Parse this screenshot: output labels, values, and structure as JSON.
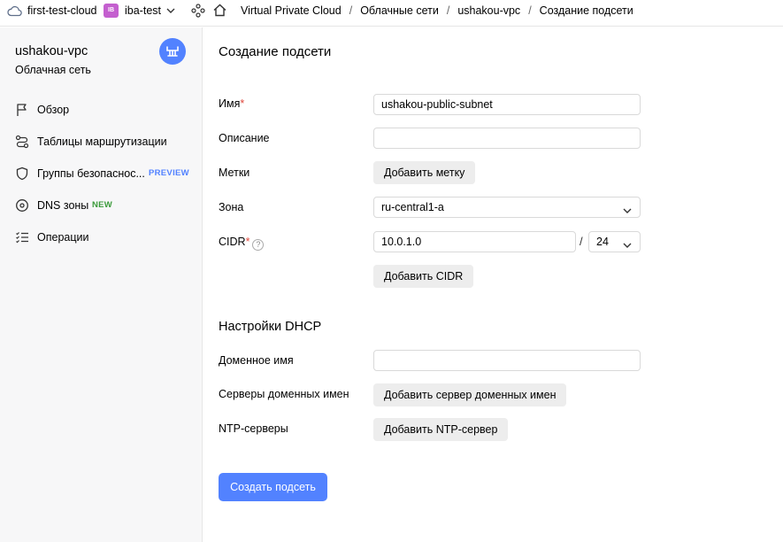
{
  "topbar": {
    "cloud_name": "first-test-cloud",
    "folder_badge": "IB",
    "folder_name": "iba-test",
    "breadcrumbs": [
      "Virtual Private Cloud",
      "Облачные сети",
      "ushakou-vpc",
      "Создание подсети"
    ],
    "icons": [
      "cloud-icon",
      "chevron-down-icon",
      "services-icon",
      "home-icon"
    ]
  },
  "sidebar": {
    "title": "ushakou-vpc",
    "subtitle": "Облачная сеть",
    "items": [
      {
        "label": "Обзор",
        "icon": "flag-icon"
      },
      {
        "label": "Таблицы маршрутизации",
        "icon": "route-icon"
      },
      {
        "label": "Группы безопаснос...",
        "icon": "shield-icon",
        "badge": "PREVIEW"
      },
      {
        "label": "DNS зоны",
        "icon": "compass-icon",
        "badge": "NEW"
      },
      {
        "label": "Операции",
        "icon": "list-icon"
      }
    ]
  },
  "form": {
    "title": "Создание подсети",
    "name_label": "Имя",
    "name_value": "ushakou-public-subnet",
    "description_label": "Описание",
    "description_value": "",
    "labels_label": "Метки",
    "add_label_button": "Добавить метку",
    "zone_label": "Зона",
    "zone_value": "ru-central1-a",
    "cidr_label": "CIDR",
    "cidr_help": "?",
    "cidr_value": "10.0.1.0",
    "cidr_separator": "/",
    "cidr_mask": "24",
    "add_cidr_button": "Добавить CIDR",
    "dhcp_title": "Настройки DHCP",
    "domain_label": "Доменное имя",
    "domain_value": "",
    "dns_label": "Серверы доменных имен",
    "add_dns_button": "Добавить сервер доменных имен",
    "ntp_label": "NTP-серверы",
    "add_ntp_button": "Добавить NTP-сервер",
    "required_mark": "*",
    "submit_button": "Создать подсеть"
  },
  "colors": {
    "accent": "#5282ff",
    "required": "#e0483d",
    "badge_new": "#3a9a3a",
    "folder_badge": "#c45fcf"
  }
}
